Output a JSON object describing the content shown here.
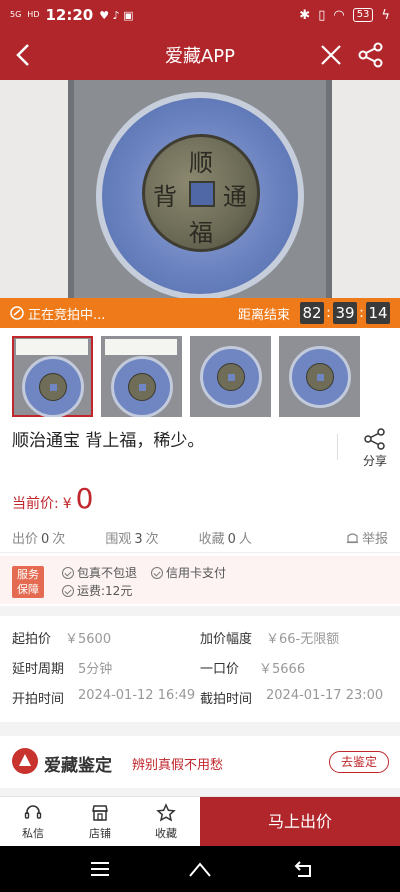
{
  "status_bar": {
    "network": "5G",
    "hd": "HD",
    "time": "12:20",
    "battery": "53"
  },
  "nav": {
    "title": "爱藏APP",
    "back_icon": "chevron-left-icon",
    "close_icon": "close-icon",
    "share_icon": "share-icon"
  },
  "auction": {
    "status": "正在竞拍中...",
    "ends_label": "距离结束",
    "countdown": {
      "hours": "82",
      "minutes": "39",
      "seconds": "14"
    }
  },
  "thumbnails": {
    "count": 4,
    "active_index": 0
  },
  "item": {
    "title": "顺治通宝 背上福，稀少。",
    "share_label": "分享"
  },
  "price": {
    "label": "当前价:",
    "currency": "¥",
    "value": "0"
  },
  "stats": {
    "bids_label": "出价",
    "bids": "0",
    "bids_unit": "次",
    "views_label": "围观",
    "views": "3",
    "views_unit": "次",
    "fav_label": "收藏",
    "favs": "0",
    "fav_unit": "人",
    "report": "举报"
  },
  "service": {
    "badge": "服务保障",
    "items": [
      "包真不包退",
      "信用卡支付",
      "运费:12元"
    ]
  },
  "details": {
    "start_price_label": "起拍价",
    "start_price": "￥5600",
    "increment_label": "加价幅度",
    "increment": "￥66-无限额",
    "delay_label": "延时周期",
    "delay": "5分钟",
    "buyout_label": "一口价",
    "buyout": "￥5666",
    "start_time_label": "开拍时间",
    "start_time": "2024-01-12 16:49",
    "end_time_label": "截拍时间",
    "end_time": "2024-01-17 23:00"
  },
  "appraise": {
    "brand": "爱藏鉴定",
    "slogan": "辨别真假不用愁",
    "button": "去鉴定"
  },
  "bottom_bar": {
    "message": "私信",
    "shop": "店铺",
    "favorite": "收藏",
    "cta": "马上出价"
  },
  "colors": {
    "brand_red": "#b1262b",
    "auction_orange": "#ef7a1a",
    "price_red": "#c0262b"
  }
}
